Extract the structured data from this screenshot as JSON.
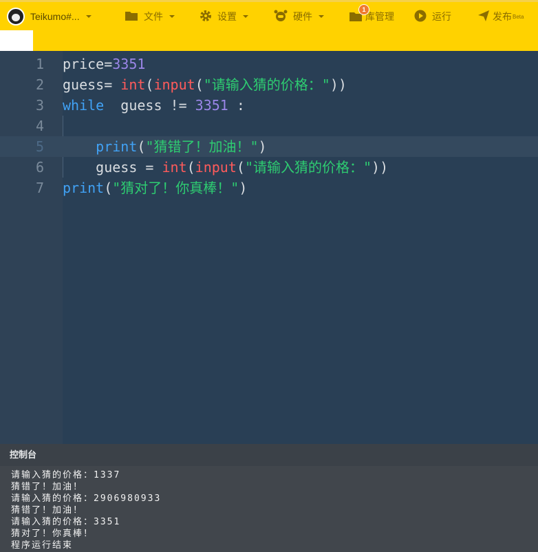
{
  "toolbar": {
    "project_name": "Teikumo#...",
    "file_label": "文件",
    "settings_label": "设置",
    "hardware_label": "硬件",
    "library_label": "库管理",
    "library_badge": "1",
    "run_label": "运行",
    "publish_label": "发布",
    "publish_tag": "Beta",
    "accent_color": "#ffd200"
  },
  "editor": {
    "line_numbers": [
      "1",
      "2",
      "3",
      "4",
      "5",
      "6",
      "7"
    ],
    "lines": {
      "l1": {
        "a": "price=",
        "b": "3351"
      },
      "l2": {
        "a": "guess= ",
        "fn1": "int",
        "p1": "(",
        "fn2": "input",
        "p2": "(",
        "s": "\"请输入猜的价格：\"",
        "p3": "))"
      },
      "l3": {
        "kw": "while",
        "a": "  guess != ",
        "n": "3351",
        "b": " :"
      },
      "l5": {
        "indent": "    ",
        "kw": "print",
        "p1": "(",
        "s": "\"猜错了！加油！\"",
        "p2": ")"
      },
      "l6": {
        "a": "    guess = ",
        "fn1": "int",
        "p1": "(",
        "fn2": "input",
        "p2": "(",
        "s": "\"请输入猜的价格：\"",
        "p3": "))"
      },
      "l7": {
        "kw": "print",
        "p1": "(",
        "s": "\"猜对了！你真棒！\"",
        "p2": ")"
      }
    }
  },
  "console": {
    "title": "控制台",
    "output": [
      "请输入猜的价格：1337",
      "猜错了！加油！",
      "请输入猜的价格：2906980933",
      "猜错了！加油！",
      "请输入猜的价格：3351",
      "猜对了！你真棒！",
      "程序运行结束"
    ]
  }
}
